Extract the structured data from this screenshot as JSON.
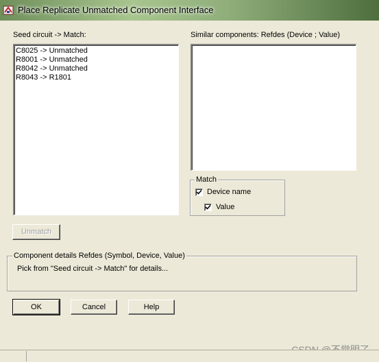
{
  "window": {
    "title": "Place Replicate Unmatched Component Interface"
  },
  "seed_list": {
    "label": "Seed circuit -> Match:",
    "items": [
      "C8025 -> Unmatched",
      "R8001 -> Unmatched",
      "R8042 -> Unmatched",
      "R8043 -> R1801"
    ]
  },
  "similar_list": {
    "label": "Similar components:  Refdes  (Device ; Value)",
    "items": []
  },
  "match_group": {
    "legend": "Match",
    "device_name": {
      "label": "Device name",
      "checked": true
    },
    "value": {
      "label": "Value",
      "checked": true
    }
  },
  "unmatch_button": {
    "label": "Unmatch",
    "enabled": false
  },
  "details_group": {
    "legend": "Component details  Refdes (Symbol, Device, Value)",
    "text": "Pick from \"Seed circuit -> Match\" for details..."
  },
  "buttons": {
    "ok": "OK",
    "cancel": "Cancel",
    "help": "Help"
  },
  "watermark": "CSDN @不觉明了"
}
